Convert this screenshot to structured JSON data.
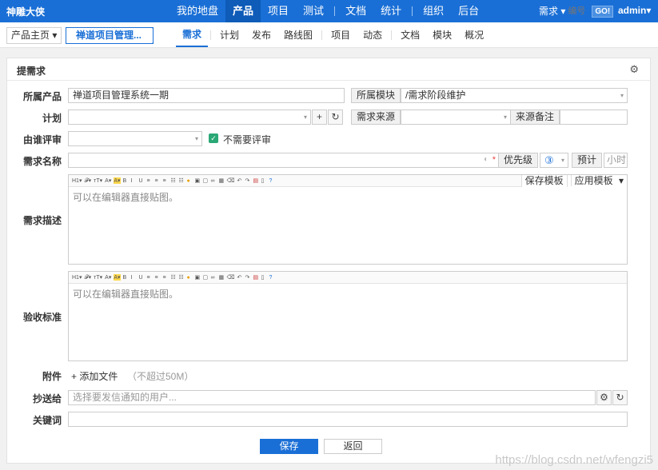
{
  "topbar": {
    "brand": "神雕大侠",
    "nav": [
      "我的地盘",
      "产品",
      "项目",
      "测试",
      "文档",
      "统计",
      "组织",
      "后台"
    ],
    "active_index": 1,
    "search_type": "需求",
    "search_placeholder": "编号",
    "go_label": "GO!",
    "user": "admin"
  },
  "subbar": {
    "crumb_root": "产品主页",
    "crumb_product": "禅道项目管理...",
    "nav": [
      "需求",
      "计划",
      "发布",
      "路线图",
      "项目",
      "动态",
      "文档",
      "模块",
      "概况"
    ],
    "active_index": 0
  },
  "form": {
    "panel_title": "提需求",
    "labels": {
      "product": "所属产品",
      "plan": "计划",
      "reviewer": "由谁评审",
      "title": "需求名称",
      "spec": "需求描述",
      "verify": "验收标准",
      "files": "附件",
      "mailto": "抄送给",
      "keywords": "关键词"
    },
    "product_value": "禅道项目管理系统一期",
    "module_label": "所属模块",
    "module_value": "/需求阶段维护",
    "source_label": "需求来源",
    "source_note_label": "来源备注",
    "no_review_label": "不需要评审",
    "priority_label": "优先级",
    "priority_value": "③",
    "estimate_label": "预计",
    "estimate_unit": "小时",
    "editor_placeholder": "可以在编辑器直接贴图。",
    "save_template": "保存模板",
    "apply_template": "应用模板",
    "add_file": "+ 添加文件",
    "file_limit": "（不超过50M）",
    "mailto_placeholder": "选择要发信通知的用户...",
    "save_button": "保存",
    "back_button": "返回"
  },
  "watermark": "https://blog.csdn.net/wfengzi5"
}
